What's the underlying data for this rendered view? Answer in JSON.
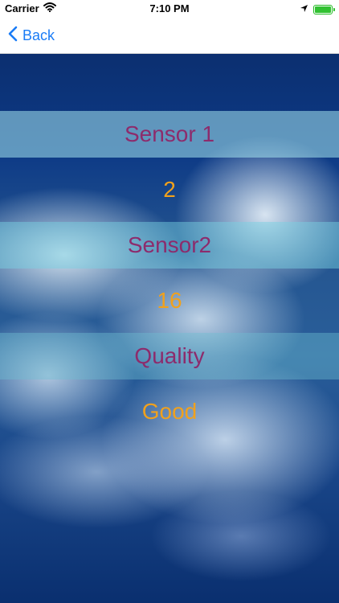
{
  "status_bar": {
    "carrier": "Carrier",
    "time": "7:10 PM"
  },
  "nav": {
    "back_label": "Back"
  },
  "rows": [
    {
      "text": "Sensor 1"
    },
    {
      "text": "2"
    },
    {
      "text": "Sensor2"
    },
    {
      "text": "16"
    },
    {
      "text": "Quality"
    },
    {
      "text": "Good"
    }
  ],
  "colors": {
    "accent_blue": "#1a7cf6",
    "label_purple": "#8d2b6c",
    "value_orange": "#f1a11c",
    "band_cyan": "#a5e6ee"
  }
}
